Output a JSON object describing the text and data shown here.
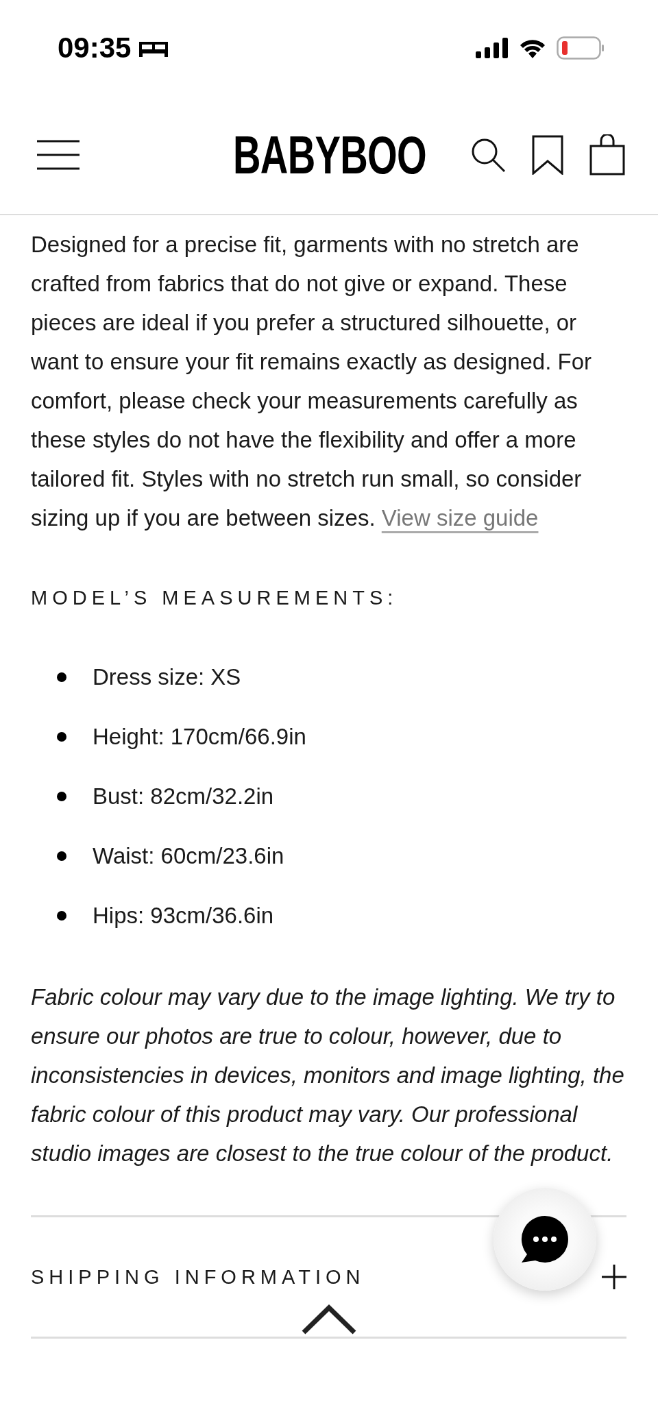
{
  "status_bar": {
    "time": "09:35"
  },
  "header": {
    "logo": "BABYBOO"
  },
  "fit_description": {
    "text": "Designed for a precise fit, garments with no stretch are crafted from fabrics that do not give or expand. These pieces are ideal if you prefer a structured silhouette, or want to ensure your fit remains exactly as designed. For comfort, please check your measurements carefully as these styles do not have the flexibility and offer a more tailored fit. Styles with no stretch run small, so consider sizing up if you are between sizes.",
    "link": "View size guide"
  },
  "measurements": {
    "heading": "MODEL’S MEASUREMENTS:",
    "items": [
      "Dress size: XS",
      "Height: 170cm/66.9in",
      "Bust: 82cm/32.2in",
      "Waist: 60cm/23.6in",
      "Hips: 93cm/36.6in"
    ]
  },
  "disclaimer": "Fabric colour may vary due to the image lighting. We try to ensure our photos are true to colour, however, due to inconsistencies in devices, monitors and image lighting, the fabric colour of this product may vary. Our professional studio images are closest to the true colour of the product.",
  "accordion": [
    {
      "title": "SHIPPING INFORMATION",
      "expanded": false
    }
  ]
}
